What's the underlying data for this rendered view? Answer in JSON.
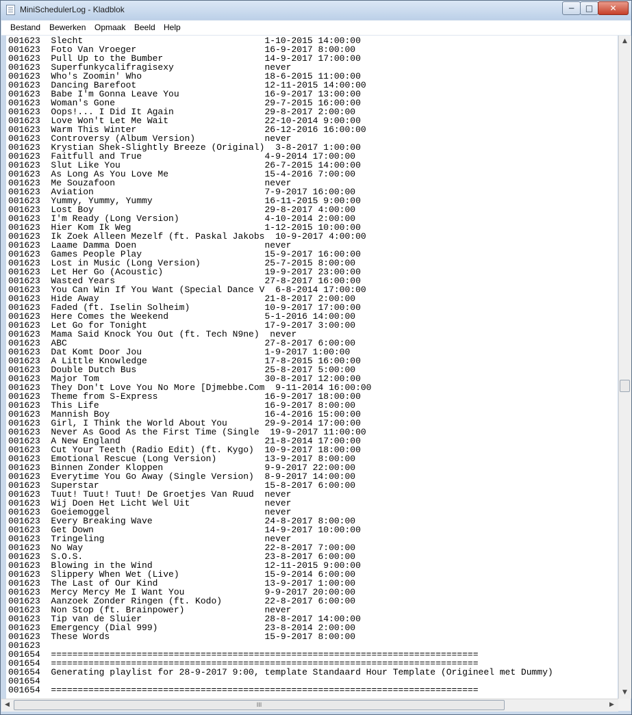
{
  "window": {
    "title": "MiniSchedulerLog - Kladblok",
    "controls": {
      "minimize": "−",
      "maximize": "□",
      "close": "✕"
    }
  },
  "menu": [
    "Bestand",
    "Bewerken",
    "Opmaak",
    "Beeld",
    "Help"
  ],
  "editor": {
    "lines": [
      "001623  Slecht                                  1-10-2015 14:00:00",
      "001623  Foto Van Vroeger                        16-9-2017 8:00:00",
      "001623  Pull Up to the Bumber                   14-9-2017 17:00:00",
      "001623  Superfunkycalifragisexy                 never",
      "001623  Who's Zoomin' Who                       18-6-2015 11:00:00",
      "001623  Dancing Barefoot                        12-11-2015 14:00:00",
      "001623  Babe I'm Gonna Leave You                16-9-2017 13:00:00",
      "001623  Woman's Gone                            29-7-2015 16:00:00",
      "001623  Oops!... I Did It Again                 29-8-2017 2:00:00",
      "001623  Love Won't Let Me Wait                  22-10-2014 9:00:00",
      "001623  Warm This Winter                        26-12-2016 16:00:00",
      "001623  Controversy (Album Version)             never",
      "001623  Krystian Shek-Slightly Breeze (Original)  3-8-2017 1:00:00",
      "001623  Faitfull and True                       4-9-2014 17:00:00",
      "001623  Slut Like You                           26-7-2015 14:00:00",
      "001623  As Long As You Love Me                  15-4-2016 7:00:00",
      "001623  Me Souzafoon                            never",
      "001623  Aviation                                7-9-2017 16:00:00",
      "001623  Yummy, Yummy, Yummy                     16-11-2015 9:00:00",
      "001623  Lost Boy                                29-8-2017 4:00:00",
      "001623  I'm Ready (Long Version)                4-10-2014 2:00:00",
      "001623  Hier Kom Ik Weg                         1-12-2015 10:00:00",
      "001623  Ik Zoek Alleen Mezelf (ft. Paskal Jakobs  10-9-2017 4:00:00",
      "001623  Laame Damma Doen                        never",
      "001623  Games People Play                       15-9-2017 16:00:00",
      "001623  Lost in Music (Long Version)            25-7-2015 8:00:00",
      "001623  Let Her Go (Acoustic)                   19-9-2017 23:00:00",
      "001623  Wasted Years                            27-8-2017 16:00:00",
      "001623  You Can Win If You Want (Special Dance V  6-8-2014 17:00:00",
      "001623  Hide Away                               21-8-2017 2:00:00",
      "001623  Faded (ft. Iselin Solheim)              10-9-2017 17:00:00",
      "001623  Here Comes the Weekend                  5-1-2016 14:00:00",
      "001623  Let Go for Tonight                      17-9-2017 3:00:00",
      "001623  Mama Said Knock You Out (ft. Tech N9ne)  never",
      "001623  ABC                                     27-8-2017 6:00:00",
      "001623  Dat Komt Door Jou                       1-9-2017 1:00:00",
      "001623  A Little Knowledge                      17-8-2015 16:00:00",
      "001623  Double Dutch Bus                        25-8-2017 5:00:00",
      "001623  Major Tom                               30-8-2017 12:00:00",
      "001623  They Don't Love You No More [Djmebbe.Com  9-11-2014 16:00:00",
      "001623  Theme from S-Express                    16-9-2017 18:00:00",
      "001623  This Life                               16-9-2017 8:00:00",
      "001623  Mannish Boy                             16-4-2016 15:00:00",
      "001623  Girl, I Think the World About You       29-9-2014 17:00:00",
      "001623  Never As Good As the First Time (Single  19-9-2017 11:00:00",
      "001623  A New England                           21-8-2014 17:00:00",
      "001623  Cut Your Teeth (Radio Edit) (ft. Kygo)  10-9-2017 18:00:00",
      "001623  Emotional Rescue (Long Version)         13-9-2017 8:00:00",
      "001623  Binnen Zonder Kloppen                   9-9-2017 22:00:00",
      "001623  Everytime You Go Away (Single Version)  8-9-2017 14:00:00",
      "001623  Superstar                               15-8-2017 6:00:00",
      "001623  Tuut! Tuut! Tuut! De Groetjes Van Ruud  never",
      "001623  Wij Doen Het Licht Wel Uit              never",
      "001623  Goeiemoggel                             never",
      "001623  Every Breaking Wave                     24-8-2017 8:00:00",
      "001623  Get Down                                14-9-2017 10:00:00",
      "001623  Tringeling                              never",
      "001623  No Way                                  22-8-2017 7:00:00",
      "001623  S.O.S.                                  23-8-2017 6:00:00",
      "001623  Blowing in the Wind                     12-11-2015 9:00:00",
      "001623  Slippery When Wet (Live)                15-9-2014 6:00:00",
      "001623  The Last of Our Kind                    13-9-2017 1:00:00",
      "001623  Mercy Mercy Me I Want You               9-9-2017 20:00:00",
      "001623  Aanzoek Zonder Ringen (ft. Kodo)        22-8-2017 6:00:00",
      "001623  Non Stop (ft. Brainpower)               never",
      "001623  Tip van de Sluier                       28-8-2017 14:00:00",
      "001623  Emergency (Dial 999)                    23-8-2014 2:00:00",
      "001623  These Words                             15-9-2017 8:00:00",
      "001623",
      "001654  ================================================================================",
      "001654  ================================================================================",
      "001654  Generating playlist for 28-9-2017 9:00, template Standaard Hour Template (Origineel met Dummy)",
      "001654",
      "001654  ================================================================================"
    ]
  },
  "scrollbars": {
    "vertical": {
      "up": "▲",
      "down": "▼",
      "position_fraction": 0.53
    },
    "horizontal": {
      "left": "◀",
      "right": "▶",
      "grip": "III"
    }
  }
}
